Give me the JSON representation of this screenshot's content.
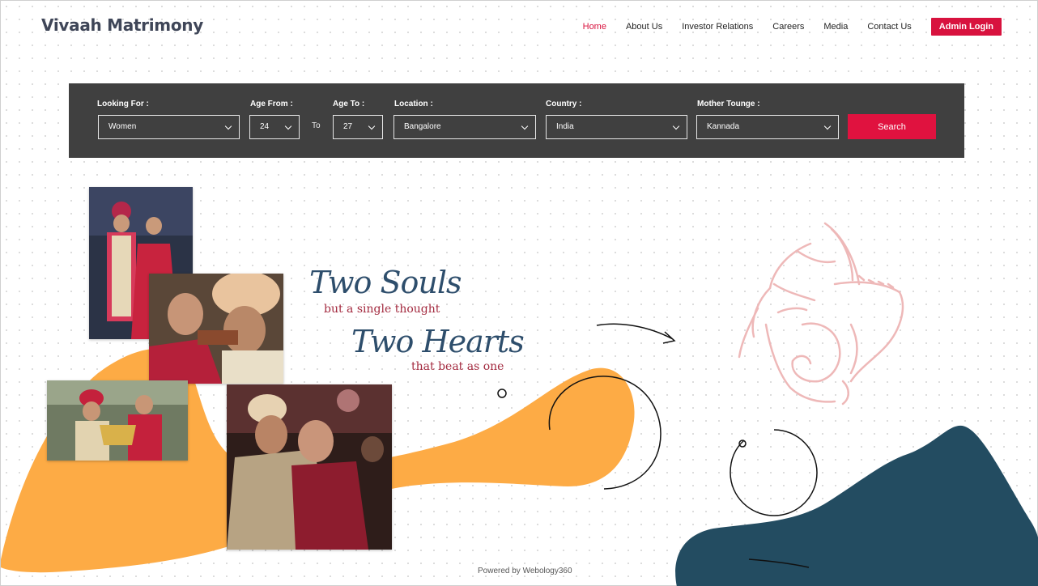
{
  "header": {
    "brand": "Vivaah Matrimony",
    "nav": [
      {
        "label": "Home",
        "active": true
      },
      {
        "label": "About Us"
      },
      {
        "label": "Investor Relations"
      },
      {
        "label": "Careers"
      },
      {
        "label": "Media"
      },
      {
        "label": "Contact Us"
      }
    ],
    "admin_label": "Admin Login"
  },
  "search": {
    "looking_for": {
      "label": "Looking For :",
      "value": "Women"
    },
    "age_from": {
      "label": "Age From :",
      "value": "24"
    },
    "to_label": "To",
    "age_to": {
      "label": "Age To :",
      "value": "27"
    },
    "location": {
      "label": "Location :",
      "value": "Bangalore"
    },
    "country": {
      "label": "Country :",
      "value": "India"
    },
    "mother_tongue": {
      "label": "Mother Tounge :",
      "value": "Kannada"
    },
    "button_label": "Search"
  },
  "hero": {
    "line1": "Two Souls",
    "line2": "but a single thought",
    "line3": "Two Hearts",
    "line4": "that beat as one"
  },
  "footer": {
    "powered_by": "Powered by Webology360"
  },
  "colors": {
    "accent": "#d8123e",
    "search_bg": "#404040",
    "blob_orange": "#fdab45",
    "blob_navy": "#234c61",
    "ganesha_pink": "#eeb8b8"
  },
  "icons": [
    "chevron-down-icon",
    "arrow-icon",
    "ganesha-illustration"
  ]
}
